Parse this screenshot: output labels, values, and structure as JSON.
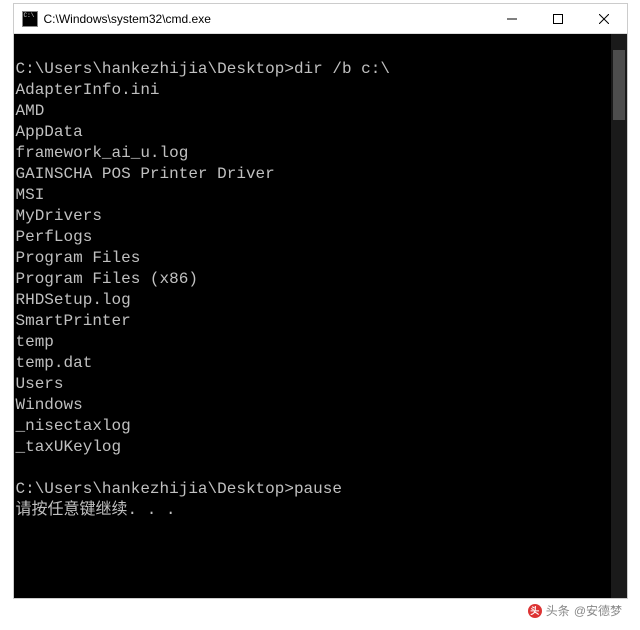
{
  "window": {
    "title": "C:\\Windows\\system32\\cmd.exe"
  },
  "terminal": {
    "prompt1_path": "C:\\Users\\hankezhijia\\Desktop>",
    "command1": "dir /b c:\\",
    "output": [
      "AdapterInfo.ini",
      "AMD",
      "AppData",
      "framework_ai_u.log",
      "GAINSCHA POS Printer Driver",
      "MSI",
      "MyDrivers",
      "PerfLogs",
      "Program Files",
      "Program Files (x86)",
      "RHDSetup.log",
      "SmartPrinter",
      "temp",
      "temp.dat",
      "Users",
      "Windows",
      "_nisectaxlog",
      "_taxUKeylog"
    ],
    "prompt2_path": "C:\\Users\\hankezhijia\\Desktop>",
    "command2": "pause",
    "pause_msg": "请按任意键继续. . ."
  },
  "watermark": {
    "prefix": "头条",
    "author": "@安德梦"
  }
}
